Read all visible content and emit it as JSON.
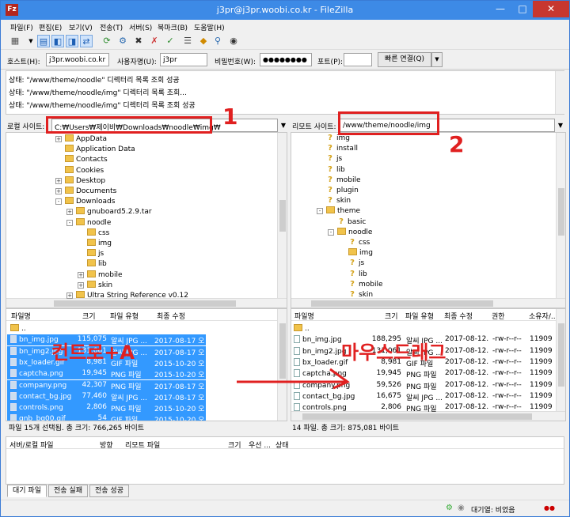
{
  "window": {
    "title": "j3pr@j3pr.woobi.co.kr - FileZilla",
    "app_icon": "Fz"
  },
  "menu": [
    "파일(F)",
    "편집(E)",
    "보기(V)",
    "전송(T)",
    "서버(S)",
    "북마크(B)",
    "도움말(H)"
  ],
  "quickconnect": {
    "host_label": "호스트(H):",
    "host": "j3pr.woobi.co.kr",
    "user_label": "사용자명(U):",
    "user": "j3pr",
    "pass_label": "비밀번호(W):",
    "pass": "●●●●●●●●",
    "port_label": "포트(P):",
    "port": "",
    "button": "빠른 연결(Q)"
  },
  "log": [
    "상태:  \"/www/theme/noodle\" 디렉터리 목록 조회 성공",
    "상태:  \"/www/theme/noodle/img\" 디렉터리 목록 조회...",
    "상태:  \"/www/theme/noodle/img\" 디렉터리 목록 조회 성공"
  ],
  "local": {
    "path_label": "로컬 사이트:",
    "path": "C:₩Users₩제이비₩Downloads₩noodle₩img₩",
    "tree": [
      {
        "label": "AppData",
        "depth": 0,
        "expander": "+"
      },
      {
        "label": "Application Data",
        "depth": 0,
        "expander": ""
      },
      {
        "label": "Contacts",
        "depth": 0,
        "expander": ""
      },
      {
        "label": "Cookies",
        "depth": 0,
        "expander": ""
      },
      {
        "label": "Desktop",
        "depth": 0,
        "expander": "+"
      },
      {
        "label": "Documents",
        "depth": 0,
        "expander": "+"
      },
      {
        "label": "Downloads",
        "depth": 0,
        "expander": "-"
      },
      {
        "label": "gnuboard5.2.9.tar",
        "depth": 1,
        "expander": "+"
      },
      {
        "label": "noodle",
        "depth": 1,
        "expander": "-"
      },
      {
        "label": "css",
        "depth": 2,
        "expander": ""
      },
      {
        "label": "img",
        "depth": 2,
        "expander": ""
      },
      {
        "label": "js",
        "depth": 2,
        "expander": ""
      },
      {
        "label": "lib",
        "depth": 2,
        "expander": ""
      },
      {
        "label": "mobile",
        "depth": 2,
        "expander": "+"
      },
      {
        "label": "skin",
        "depth": 2,
        "expander": "+"
      },
      {
        "label": "Ultra String Reference v0.12",
        "depth": 1,
        "expander": "+"
      }
    ],
    "columns": [
      "파일명",
      "크기",
      "파일 유형",
      "최종 수정"
    ],
    "files": [
      {
        "name": "..",
        "size": "",
        "type": "",
        "date": "",
        "sel": false
      },
      {
        "name": "bn_img.jpg",
        "size": "115,075",
        "type": "알씨 JPG ...",
        "date": "2017-08-17 오...",
        "sel": true
      },
      {
        "name": "bn_img2.jpg",
        "size": "131,061",
        "type": "알씨 JPG ...",
        "date": "2017-08-17 오...",
        "sel": true
      },
      {
        "name": "bx_loader.gif",
        "size": "8,981",
        "type": "GIF 파일",
        "date": "2015-10-20 오...",
        "sel": true
      },
      {
        "name": "captcha.png",
        "size": "19,945",
        "type": "PNG 파일",
        "date": "2015-10-20 오...",
        "sel": true
      },
      {
        "name": "company.png",
        "size": "42,307",
        "type": "PNG 파일",
        "date": "2017-08-17 오...",
        "sel": true
      },
      {
        "name": "contact_bg.jpg",
        "size": "77,460",
        "type": "알씨 JPG ...",
        "date": "2017-08-17 오...",
        "sel": true
      },
      {
        "name": "controls.png",
        "size": "2,806",
        "type": "PNG 파일",
        "date": "2015-10-20 오...",
        "sel": true
      },
      {
        "name": "gnb_bg00.gif",
        "size": "54",
        "type": "GIF 파일",
        "date": "2015-10-20 오...",
        "sel": true
      }
    ],
    "status": "파일 15개 선택됨. 총 크기: 766,265 바이트"
  },
  "remote": {
    "path_label": "리모트 사이트:",
    "path": "/www/theme/noodle/img",
    "tree": [
      {
        "label": "img",
        "depth": 0,
        "expander": "",
        "kind": "q"
      },
      {
        "label": "install",
        "depth": 0,
        "expander": "",
        "kind": "q"
      },
      {
        "label": "js",
        "depth": 0,
        "expander": "",
        "kind": "q"
      },
      {
        "label": "lib",
        "depth": 0,
        "expander": "",
        "kind": "q"
      },
      {
        "label": "mobile",
        "depth": 0,
        "expander": "",
        "kind": "q"
      },
      {
        "label": "plugin",
        "depth": 0,
        "expander": "",
        "kind": "q"
      },
      {
        "label": "skin",
        "depth": 0,
        "expander": "",
        "kind": "q"
      },
      {
        "label": "theme",
        "depth": 0,
        "expander": "-",
        "kind": "f"
      },
      {
        "label": "basic",
        "depth": 1,
        "expander": "",
        "kind": "q"
      },
      {
        "label": "noodle",
        "depth": 1,
        "expander": "-",
        "kind": "f"
      },
      {
        "label": "css",
        "depth": 2,
        "expander": "",
        "kind": "q"
      },
      {
        "label": "img",
        "depth": 2,
        "expander": "",
        "kind": "f"
      },
      {
        "label": "js",
        "depth": 2,
        "expander": "",
        "kind": "q"
      },
      {
        "label": "lib",
        "depth": 2,
        "expander": "",
        "kind": "q"
      },
      {
        "label": "mobile",
        "depth": 2,
        "expander": "",
        "kind": "q"
      },
      {
        "label": "skin",
        "depth": 2,
        "expander": "",
        "kind": "q"
      }
    ],
    "columns": [
      "파일명",
      "크기",
      "파일 유형",
      "최종 수정",
      "권한",
      "소유자/..."
    ],
    "files": [
      {
        "name": "..",
        "size": "",
        "type": "",
        "date": "",
        "perm": "",
        "owner": ""
      },
      {
        "name": "bn_img.jpg",
        "size": "188,295",
        "type": "알씨 JPG ...",
        "date": "2017-08-12...",
        "perm": "-rw-r--r--",
        "owner": "11909 5..."
      },
      {
        "name": "bn_img2.jpg",
        "size": "131,061",
        "type": "알씨 JPG ...",
        "date": "2017-08-12...",
        "perm": "-rw-r--r--",
        "owner": "11909 5..."
      },
      {
        "name": "bx_loader.gif",
        "size": "8,981",
        "type": "GIF 파일",
        "date": "2017-08-12...",
        "perm": "-rw-r--r--",
        "owner": "11909 5..."
      },
      {
        "name": "captcha.png",
        "size": "19,945",
        "type": "PNG 파일",
        "date": "2017-08-12...",
        "perm": "-rw-r--r--",
        "owner": "11909 5..."
      },
      {
        "name": "company.png",
        "size": "59,526",
        "type": "PNG 파일",
        "date": "2017-08-12...",
        "perm": "-rw-r--r--",
        "owner": "11909 5..."
      },
      {
        "name": "contact_bg.jpg",
        "size": "16,675",
        "type": "알씨 JPG ...",
        "date": "2017-08-12...",
        "perm": "-rw-r--r--",
        "owner": "11909 5..."
      },
      {
        "name": "controls.png",
        "size": "2,806",
        "type": "PNG 파일",
        "date": "2017-08-12...",
        "perm": "-rw-r--r--",
        "owner": "11909 5..."
      }
    ],
    "status": "14 파일. 총 크기: 875,081 바이트"
  },
  "queue": {
    "columns": [
      "서버/로컬 파일",
      "방향",
      "리모트 파일",
      "크기",
      "우선 ...",
      "상태"
    ]
  },
  "tabs": [
    "대기 파일",
    "전송 실패",
    "전송 성공"
  ],
  "statusbar": {
    "queue": "대기열: 비었음"
  },
  "annotations": {
    "one": "1",
    "two": "2",
    "ctrl_a": "컨트로+A",
    "drag": "마우스드래그"
  }
}
